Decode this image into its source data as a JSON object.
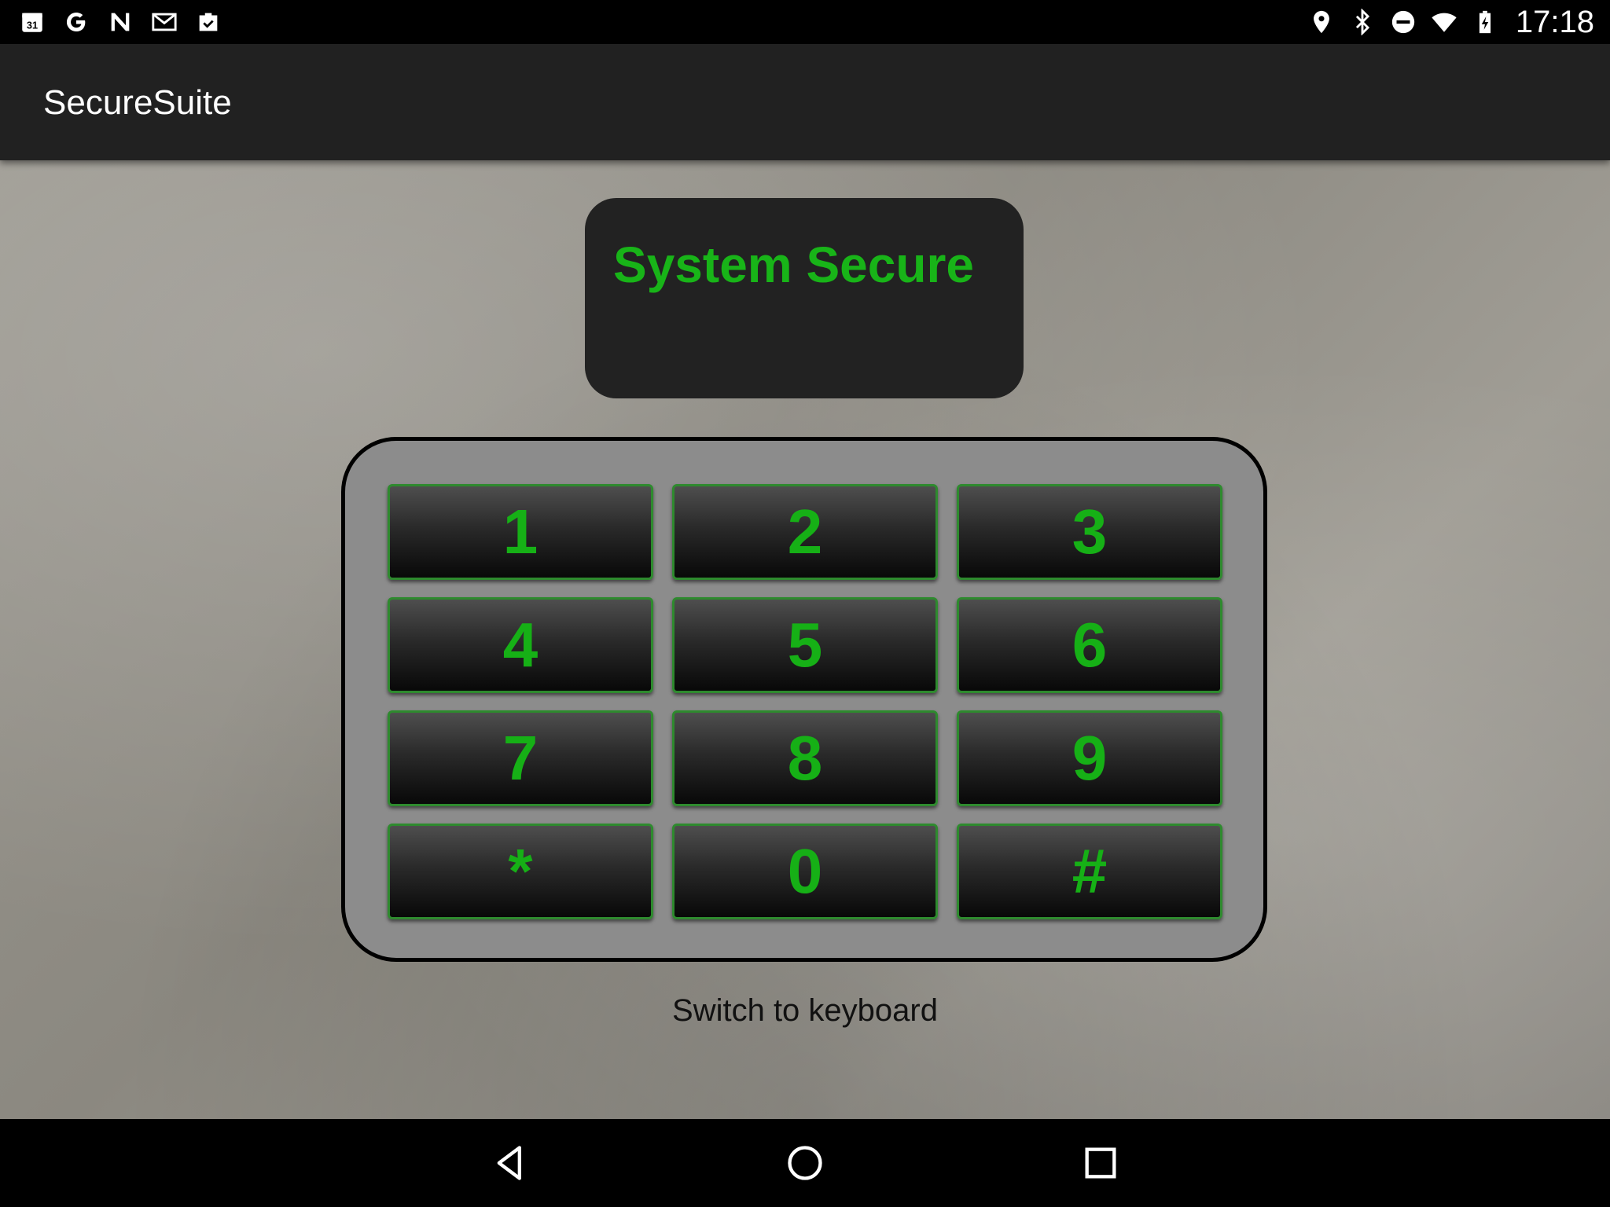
{
  "status_bar": {
    "left_icons": [
      "calendar-icon",
      "google-icon",
      "n-icon",
      "gmail-icon",
      "briefcase-check-icon"
    ],
    "calendar_day": "31",
    "right_icons": [
      "location-icon",
      "bluetooth-icon",
      "do-not-disturb-icon",
      "wifi-icon",
      "battery-charging-icon"
    ],
    "time": "17:18"
  },
  "app_bar": {
    "title": "SecureSuite"
  },
  "display": {
    "status_text": "System Secure"
  },
  "keypad": {
    "keys": [
      "1",
      "2",
      "3",
      "4",
      "5",
      "6",
      "7",
      "8",
      "9",
      "*",
      "0",
      "#"
    ]
  },
  "switch_link": "Switch to keyboard",
  "nav_bar": {
    "icons": [
      "back-icon",
      "home-icon",
      "recents-icon"
    ]
  },
  "colors": {
    "accent_green": "#16b016",
    "app_bar": "#212121",
    "display_bg": "#222222",
    "keypad_bg": "#8c8c8c"
  }
}
